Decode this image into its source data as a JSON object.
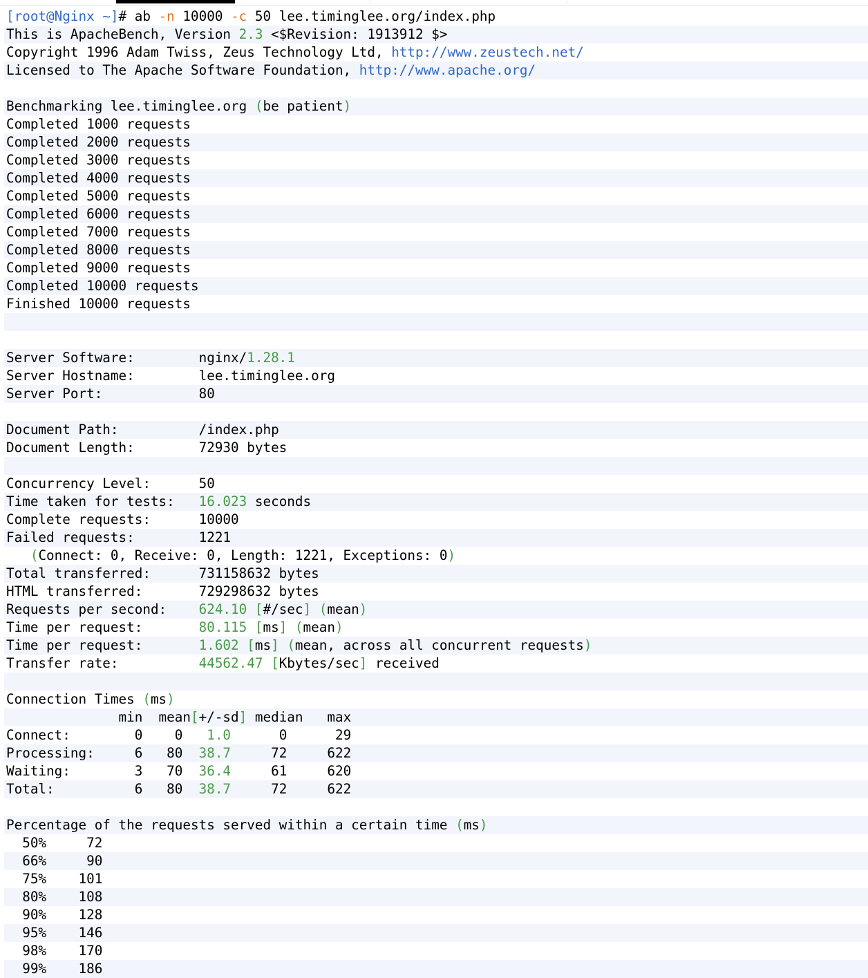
{
  "colors": {
    "green": "#4a9a4a",
    "orange": "#e0741f",
    "blue": "#3169c6",
    "stripe": "#f2f5fb"
  },
  "tabs": [
    "",
    "",
    "",
    ""
  ],
  "lines": [
    [
      {
        "t": "[root@Nginx ~]",
        "c": "b"
      },
      {
        "t": "# ab ",
        "c": "k"
      },
      {
        "t": "-n",
        "c": "o"
      },
      {
        "t": " 10000 ",
        "c": "k"
      },
      {
        "t": "-c",
        "c": "o"
      },
      {
        "t": " 50 lee.timinglee.org/index.php",
        "c": "k"
      }
    ],
    [
      {
        "t": "This is ApacheBench, Version ",
        "c": "k"
      },
      {
        "t": "2.3",
        "c": "g"
      },
      {
        "t": " <$Revision: 1913912 $>",
        "c": "k"
      }
    ],
    [
      {
        "t": "Copyright 1996 Adam Twiss, Zeus Technology Ltd, ",
        "c": "k"
      },
      {
        "t": "http://www.zeustech.net/",
        "c": "b"
      }
    ],
    [
      {
        "t": "Licensed to The Apache Software Foundation, ",
        "c": "k"
      },
      {
        "t": "http://www.apache.org/",
        "c": "b"
      }
    ],
    [],
    [
      {
        "t": "Benchmarking lee.timinglee.org ",
        "c": "k"
      },
      {
        "t": "(",
        "c": "g"
      },
      {
        "t": "be patient",
        "c": "k"
      },
      {
        "t": ")",
        "c": "g"
      }
    ],
    [
      {
        "t": "Completed 1000 requests",
        "c": "k"
      }
    ],
    [
      {
        "t": "Completed 2000 requests",
        "c": "k"
      }
    ],
    [
      {
        "t": "Completed 3000 requests",
        "c": "k"
      }
    ],
    [
      {
        "t": "Completed 4000 requests",
        "c": "k"
      }
    ],
    [
      {
        "t": "Completed 5000 requests",
        "c": "k"
      }
    ],
    [
      {
        "t": "Completed 6000 requests",
        "c": "k"
      }
    ],
    [
      {
        "t": "Completed 7000 requests",
        "c": "k"
      }
    ],
    [
      {
        "t": "Completed 8000 requests",
        "c": "k"
      }
    ],
    [
      {
        "t": "Completed 9000 requests",
        "c": "k"
      }
    ],
    [
      {
        "t": "Completed 10000 requests",
        "c": "k"
      }
    ],
    [
      {
        "t": "Finished 10000 requests",
        "c": "k"
      }
    ],
    [],
    [],
    [
      {
        "t": "Server Software:        nginx/",
        "c": "k"
      },
      {
        "t": "1.28.1",
        "c": "g"
      }
    ],
    [
      {
        "t": "Server Hostname:        lee.timinglee.org",
        "c": "k"
      }
    ],
    [
      {
        "t": "Server Port:            80",
        "c": "k"
      }
    ],
    [],
    [
      {
        "t": "Document Path:          /index.php",
        "c": "k"
      }
    ],
    [
      {
        "t": "Document Length:        72930 bytes",
        "c": "k"
      }
    ],
    [],
    [
      {
        "t": "Concurrency Level:      50",
        "c": "k"
      }
    ],
    [
      {
        "t": "Time taken for tests:   ",
        "c": "k"
      },
      {
        "t": "16.023",
        "c": "g"
      },
      {
        "t": " seconds",
        "c": "k"
      }
    ],
    [
      {
        "t": "Complete requests:      10000",
        "c": "k"
      }
    ],
    [
      {
        "t": "Failed requests:        1221",
        "c": "k"
      }
    ],
    [
      {
        "t": "   ",
        "c": "k"
      },
      {
        "t": "(",
        "c": "g"
      },
      {
        "t": "Connect: 0, Receive: 0, Length: 1221, Exceptions: 0",
        "c": "k"
      },
      {
        "t": ")",
        "c": "g"
      }
    ],
    [
      {
        "t": "Total transferred:      731158632 bytes",
        "c": "k"
      }
    ],
    [
      {
        "t": "HTML transferred:       729298632 bytes",
        "c": "k"
      }
    ],
    [
      {
        "t": "Requests per second:    ",
        "c": "k"
      },
      {
        "t": "624.10 [",
        "c": "g"
      },
      {
        "t": "#/sec",
        "c": "k"
      },
      {
        "t": "]",
        "c": "g"
      },
      {
        "t": " ",
        "c": "k"
      },
      {
        "t": "(",
        "c": "g"
      },
      {
        "t": "mean",
        "c": "k"
      },
      {
        "t": ")",
        "c": "g"
      }
    ],
    [
      {
        "t": "Time per request:       ",
        "c": "k"
      },
      {
        "t": "80.115 [",
        "c": "g"
      },
      {
        "t": "ms",
        "c": "k"
      },
      {
        "t": "]",
        "c": "g"
      },
      {
        "t": " ",
        "c": "k"
      },
      {
        "t": "(",
        "c": "g"
      },
      {
        "t": "mean",
        "c": "k"
      },
      {
        "t": ")",
        "c": "g"
      }
    ],
    [
      {
        "t": "Time per request:       ",
        "c": "k"
      },
      {
        "t": "1.602 [",
        "c": "g"
      },
      {
        "t": "ms",
        "c": "k"
      },
      {
        "t": "]",
        "c": "g"
      },
      {
        "t": " ",
        "c": "k"
      },
      {
        "t": "(",
        "c": "g"
      },
      {
        "t": "mean, across all concurrent requests",
        "c": "k"
      },
      {
        "t": ")",
        "c": "g"
      }
    ],
    [
      {
        "t": "Transfer rate:          ",
        "c": "k"
      },
      {
        "t": "44562.47 [",
        "c": "g"
      },
      {
        "t": "Kbytes/sec",
        "c": "k"
      },
      {
        "t": "]",
        "c": "g"
      },
      {
        "t": " received",
        "c": "k"
      }
    ],
    [],
    [
      {
        "t": "Connection Times ",
        "c": "k"
      },
      {
        "t": "(",
        "c": "g"
      },
      {
        "t": "ms",
        "c": "k"
      },
      {
        "t": ")",
        "c": "g"
      }
    ],
    [
      {
        "t": "              min  mean",
        "c": "k"
      },
      {
        "t": "[",
        "c": "g"
      },
      {
        "t": "+/-sd",
        "c": "k"
      },
      {
        "t": "]",
        "c": "g"
      },
      {
        "t": " median   max",
        "c": "k"
      }
    ],
    [
      {
        "t": "Connect:        0    0   ",
        "c": "k"
      },
      {
        "t": "1.0",
        "c": "g"
      },
      {
        "t": "      0      29",
        "c": "k"
      }
    ],
    [
      {
        "t": "Processing:     6   80  ",
        "c": "k"
      },
      {
        "t": "38.7",
        "c": "g"
      },
      {
        "t": "     72     622",
        "c": "k"
      }
    ],
    [
      {
        "t": "Waiting:        3   70  ",
        "c": "k"
      },
      {
        "t": "36.4",
        "c": "g"
      },
      {
        "t": "     61     620",
        "c": "k"
      }
    ],
    [
      {
        "t": "Total:          6   80  ",
        "c": "k"
      },
      {
        "t": "38.7",
        "c": "g"
      },
      {
        "t": "     72     622",
        "c": "k"
      }
    ],
    [],
    [
      {
        "t": "Percentage of the requests served within a certain time ",
        "c": "k"
      },
      {
        "t": "(",
        "c": "g"
      },
      {
        "t": "ms",
        "c": "k"
      },
      {
        "t": ")",
        "c": "g"
      }
    ],
    [
      {
        "t": "  50%     72",
        "c": "k"
      }
    ],
    [
      {
        "t": "  66%     90",
        "c": "k"
      }
    ],
    [
      {
        "t": "  75%    101",
        "c": "k"
      }
    ],
    [
      {
        "t": "  80%    108",
        "c": "k"
      }
    ],
    [
      {
        "t": "  90%    128",
        "c": "k"
      }
    ],
    [
      {
        "t": "  95%    146",
        "c": "k"
      }
    ],
    [
      {
        "t": "  98%    170",
        "c": "k"
      }
    ],
    [
      {
        "t": "  99%    186",
        "c": "k"
      }
    ]
  ]
}
